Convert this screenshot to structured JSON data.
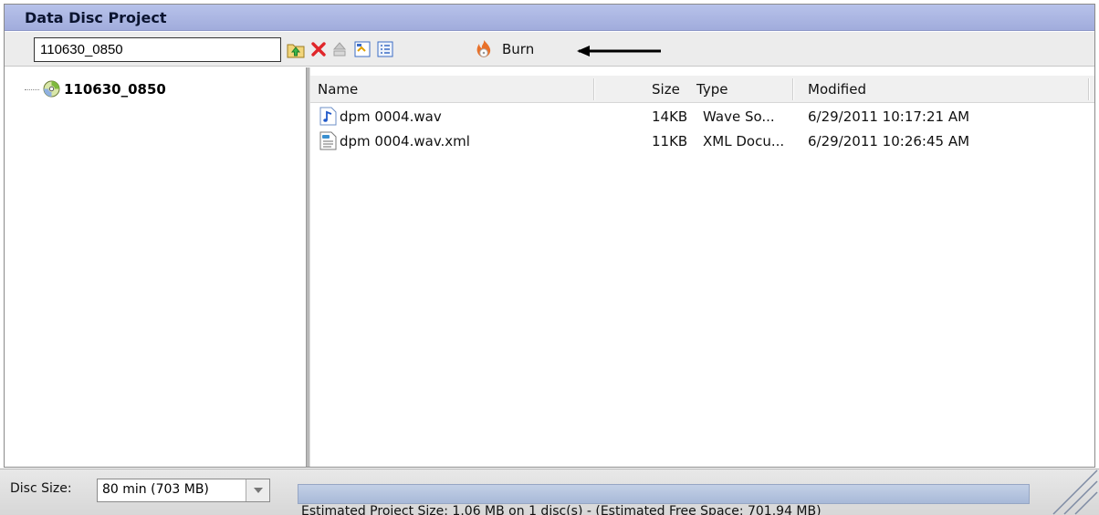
{
  "window": {
    "title": "Data Disc Project"
  },
  "toolbar": {
    "name_value": "110630_0850",
    "icons": [
      "add-files-icon",
      "delete-icon",
      "eject-icon",
      "rename-icon",
      "properties-icon"
    ],
    "burn_label": "Burn"
  },
  "tree": {
    "root_label": "110630_0850"
  },
  "list": {
    "columns": {
      "name": "Name",
      "size": "Size",
      "type": "Type",
      "modified": "Modified"
    },
    "rows": [
      {
        "name": "dpm 0004.wav",
        "size": "14KB",
        "type": "Wave So...",
        "modified": "6/29/2011 10:17:21 AM",
        "icon": "audio-file-icon"
      },
      {
        "name": "dpm 0004.wav.xml",
        "size": "11KB",
        "type": "XML Docu...",
        "modified": "6/29/2011 10:26:45 AM",
        "icon": "xml-file-icon"
      }
    ]
  },
  "status": {
    "disc_size_label": "Disc Size:",
    "disc_size_value": "80 min (703 MB)",
    "estimate_text": "Estimated Project Size: 1.06 MB on 1 disc(s) - (Estimated Free Space: 701.94 MB)"
  },
  "colors": {
    "title_bar": "#a9b4e1",
    "progress": "#b3c2de",
    "burn_flame": "#e8712a"
  }
}
